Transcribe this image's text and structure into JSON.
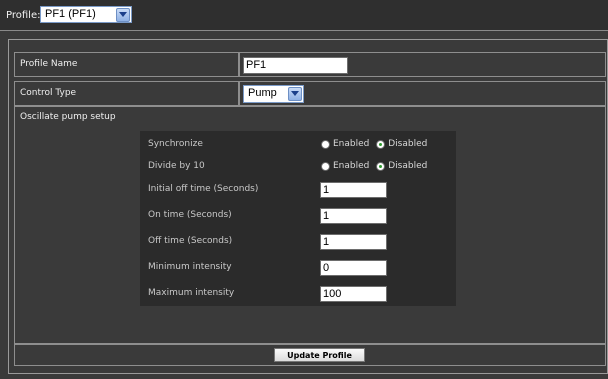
{
  "profile_bar": {
    "label": "Profile:",
    "selected": "PF1 (PF1)"
  },
  "form": {
    "profile_name": {
      "label": "Profile Name",
      "value": "PF1"
    },
    "control_type": {
      "label": "Control Type",
      "selected": "Pump"
    },
    "section_title": "Oscillate pump setup",
    "fields": {
      "synchronize": {
        "label": "Synchronize",
        "options": [
          "Enabled",
          "Disabled"
        ],
        "selected": "Disabled"
      },
      "divide_by_10": {
        "label": "Divide by 10",
        "options": [
          "Enabled",
          "Disabled"
        ],
        "selected": "Disabled"
      },
      "initial_off_time": {
        "label": "Initial off time (Seconds)",
        "value": "1"
      },
      "on_time": {
        "label": "On time (Seconds)",
        "value": "1"
      },
      "off_time": {
        "label": "Off time (Seconds)",
        "value": "1"
      },
      "min_intensity": {
        "label": "Minimum intensity",
        "value": "0"
      },
      "max_intensity": {
        "label": "Maximum intensity",
        "value": "100"
      }
    },
    "submit_label": "Update Profile"
  },
  "colors": {
    "background": "#3a3a3a",
    "panel": "#2b2b2b",
    "select_accent": "#8fb0e4",
    "radio_checked": "#2d9a2d"
  },
  "icons": {
    "dropdown": "chevron-down-icon"
  }
}
